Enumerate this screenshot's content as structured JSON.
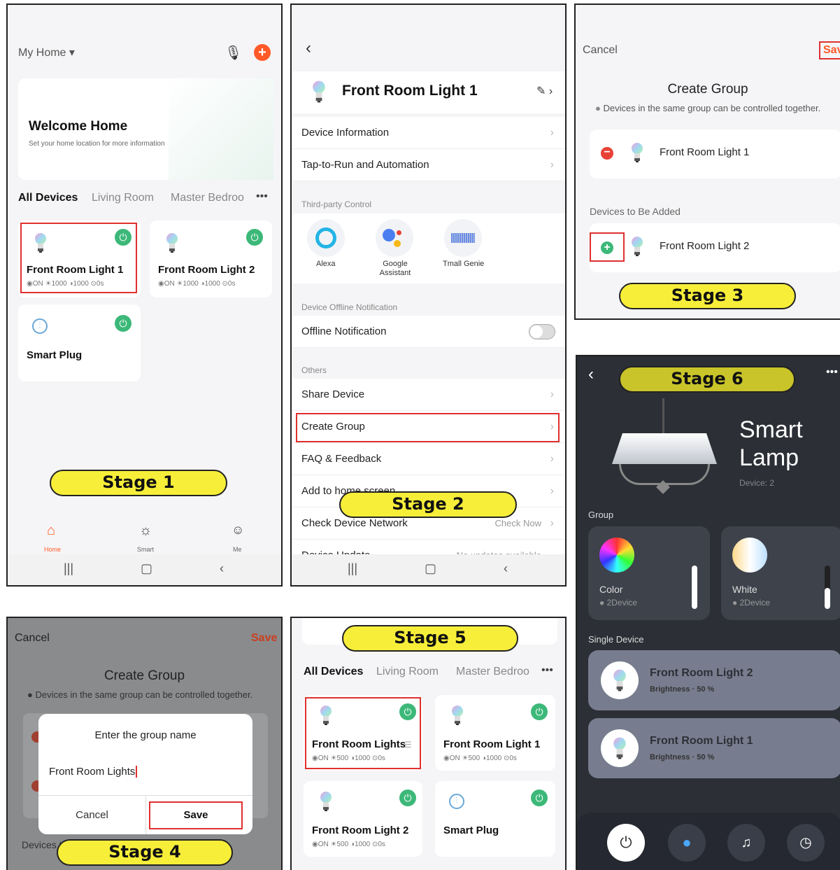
{
  "stages": {
    "s1": "Stage 1",
    "s2": "Stage 2",
    "s3": "Stage 3",
    "s4": "Stage 4",
    "s5": "Stage 5",
    "s6": "Stage 6"
  },
  "p1": {
    "home": "My Home",
    "welcome": "Welcome Home",
    "welcome_sub": "Set your home location for more information",
    "tabs": [
      "All Devices",
      "Living Room",
      "Master Bedroo"
    ],
    "more": "•••",
    "devices": [
      {
        "name": "Front Room Light 1",
        "stats": "◉ON ☀1000 ◑1000 ⊙0s"
      },
      {
        "name": "Front Room Light 2",
        "stats": "◉ON ☀1000 ◑1000 ⊙0s"
      },
      {
        "name": "Smart Plug"
      }
    ],
    "nav": [
      "Home",
      "Smart",
      "Me"
    ]
  },
  "p2": {
    "title": "Front Room Light 1",
    "rows": [
      "Device Information",
      "Tap-to-Run and Automation"
    ],
    "third_party": "Third-party Control",
    "services": [
      "Alexa",
      "Google Assistant",
      "Tmall Genie"
    ],
    "offline_section": "Device Offline Notification",
    "offline": "Offline Notification",
    "others": "Others",
    "other_rows": [
      "Share Device",
      "Create Group",
      "FAQ & Feedback",
      "Add to home screen",
      "Check Device Network",
      "Device Update"
    ],
    "check_now": "Check Now",
    "no_updates": "No updates available"
  },
  "p3": {
    "cancel": "Cancel",
    "save": "Sav",
    "title": "Create Group",
    "info": "Devices in the same group can be controlled together.",
    "d1": "Front Room Light 1",
    "to_add": "Devices to Be Added",
    "d2": "Front Room Light 2"
  },
  "p4": {
    "cancel": "Cancel",
    "save": "Save",
    "title": "Create Group",
    "info": "Devices in the same group can be controlled together.",
    "dialog_title": "Enter the group name",
    "value": "Front Room Lights",
    "btn_cancel": "Cancel",
    "btn_save": "Save",
    "to_add": "Devices to Be Added"
  },
  "p5": {
    "tabs": [
      "All Devices",
      "Living Room",
      "Master Bedroo"
    ],
    "more": "•••",
    "devices": [
      {
        "name": "Front Room Lights",
        "stats": "◉ON ☀500 ◑1000 ⊙0s"
      },
      {
        "name": "Front Room Light 1",
        "stats": "◉ON ☀500 ◑1000 ⊙0s"
      },
      {
        "name": "Front Room Light 2",
        "stats": "◉ON ☀500 ◑1000 ⊙0s"
      },
      {
        "name": "Smart Plug"
      }
    ]
  },
  "p6": {
    "title1": "Smart",
    "title2": "Lamp",
    "device": "Device: 2",
    "group": "Group",
    "color": "Color",
    "white": "White",
    "twod": "2Device",
    "twod2": "2Device",
    "single": "Single Device",
    "l2": "Front Room Light 2",
    "l1": "Front Room Light 1",
    "bright": "Brightness · 50 %",
    "bright2": "Brightness · 50 %",
    "more": "•••"
  },
  "colors": {
    "accent": "#ff5a28",
    "green": "#3cb878",
    "stage": "#f7ee3a"
  }
}
